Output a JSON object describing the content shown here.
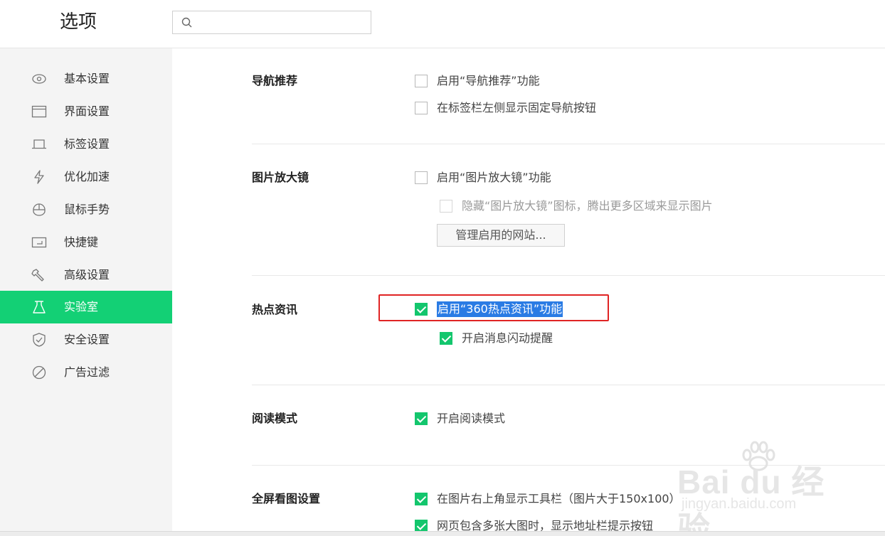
{
  "header": {
    "title": "选项",
    "search_placeholder": ""
  },
  "sidebar": {
    "items": [
      {
        "label": "基本设置",
        "icon": "eye-icon"
      },
      {
        "label": "界面设置",
        "icon": "window-icon"
      },
      {
        "label": "标签设置",
        "icon": "tab-icon"
      },
      {
        "label": "优化加速",
        "icon": "lightning-icon"
      },
      {
        "label": "鼠标手势",
        "icon": "mouse-icon"
      },
      {
        "label": "快捷键",
        "icon": "keyboard-icon"
      },
      {
        "label": "高级设置",
        "icon": "wrench-icon"
      },
      {
        "label": "实验室",
        "icon": "flask-icon",
        "active": true
      },
      {
        "label": "安全设置",
        "icon": "shield-icon"
      },
      {
        "label": "广告过滤",
        "icon": "block-icon"
      }
    ]
  },
  "sections": {
    "nav": {
      "title": "导航推荐",
      "opt1": "启用“导航推荐”功能",
      "opt2": "在标签栏左侧显示固定导航按钮"
    },
    "magnifier": {
      "title": "图片放大镜",
      "opt1": "启用“图片放大镜”功能",
      "opt2": "隐藏“图片放大镜”图标，腾出更多区域来显示图片",
      "button": "管理启用的网站..."
    },
    "hotnews": {
      "title": "热点资讯",
      "opt1": "启用“360热点资讯”功能",
      "opt2": "开启消息闪动提醒"
    },
    "reading": {
      "title": "阅读模式",
      "opt1": "开启阅读模式"
    },
    "fullscreen": {
      "title": "全屏看图设置",
      "opt1": "在图片右上角显示工具栏（图片大于150x100）",
      "opt2": "网页包含多张大图时，显示地址栏提示按钮"
    }
  },
  "watermark": {
    "logo": "Bai du 经验",
    "url": "jingyan.baidu.com"
  },
  "colors": {
    "accent": "#13d075",
    "highlight": "#2a7be4",
    "redbox": "#e02424"
  }
}
